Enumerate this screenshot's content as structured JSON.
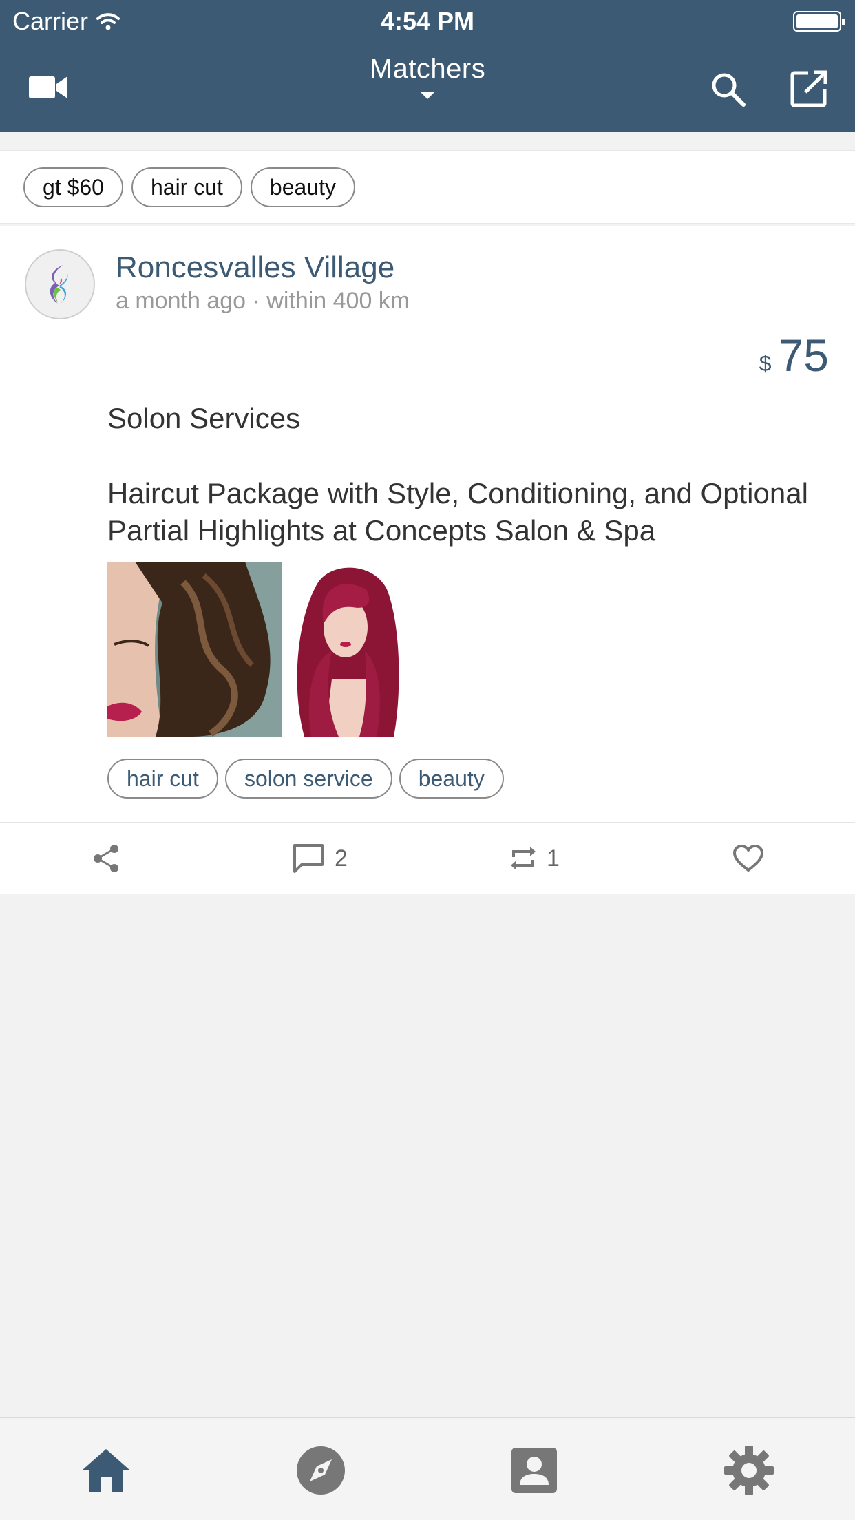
{
  "status_bar": {
    "carrier": "Carrier",
    "time": "4:54 PM"
  },
  "nav": {
    "title": "Matchers",
    "icons": {
      "left": "video-camera-icon",
      "search": "search-icon",
      "compose": "external-link-icon"
    }
  },
  "filters": [
    "gt $60",
    "hair cut",
    "beauty"
  ],
  "post": {
    "author": "Roncesvalles Village",
    "time_ago": "a month ago",
    "distance": "within 400 km",
    "meta_separator": "·",
    "currency": "$",
    "price": "75",
    "category": "Solon Services",
    "description": "Haircut Package with Style, Conditioning, and Optional Partial Highlights at Concepts Salon & Spa",
    "tags": [
      "hair cut",
      "solon service",
      "beauty"
    ],
    "actions": {
      "share_icon": "share-icon",
      "comments": "2",
      "reposts": "1",
      "like_icon": "heart-icon"
    }
  },
  "tabs": [
    "home-icon",
    "compass-icon",
    "contact-icon",
    "gear-icon"
  ],
  "colors": {
    "primary": "#3c5a73",
    "background": "#f2f2f2",
    "muted": "#999999"
  }
}
